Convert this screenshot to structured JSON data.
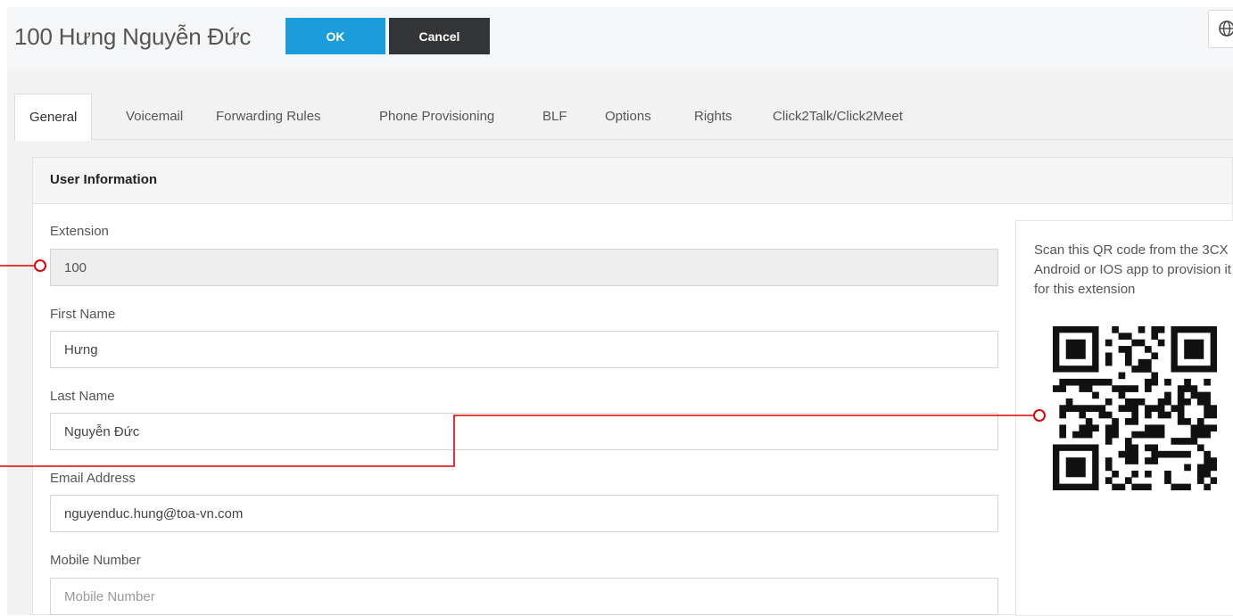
{
  "header": {
    "title": "100 Hưng Nguyễn Đức",
    "ok_label": "OK",
    "cancel_label": "Cancel"
  },
  "tabs": [
    {
      "label": "General",
      "active": true
    },
    {
      "label": "Voicemail"
    },
    {
      "label": "Forwarding Rules"
    },
    {
      "label": "Phone Provisioning"
    },
    {
      "label": "BLF"
    },
    {
      "label": "Options"
    },
    {
      "label": "Rights"
    },
    {
      "label": "Click2Talk/Click2Meet"
    }
  ],
  "panel": {
    "title": "User Information",
    "fields": {
      "extension": {
        "label": "Extension",
        "value": "100",
        "readonly": true
      },
      "first_name": {
        "label": "First Name",
        "value": "Hưng"
      },
      "last_name": {
        "label": "Last Name",
        "value": "Nguyễn Đức"
      },
      "email": {
        "label": "Email Address",
        "value": "nguyenduc.hung@toa-vn.com"
      },
      "mobile": {
        "label": "Mobile Number",
        "value": "",
        "placeholder": "Mobile Number"
      }
    },
    "qr": {
      "text": "Scan this QR code from the 3CX Android or IOS app to provision it for this extension"
    }
  },
  "colors": {
    "ok": "#1c9ddb",
    "cancel": "#333537",
    "annotation": "#e00000"
  },
  "icons": [
    "globe-icon",
    "qr-code-icon"
  ]
}
